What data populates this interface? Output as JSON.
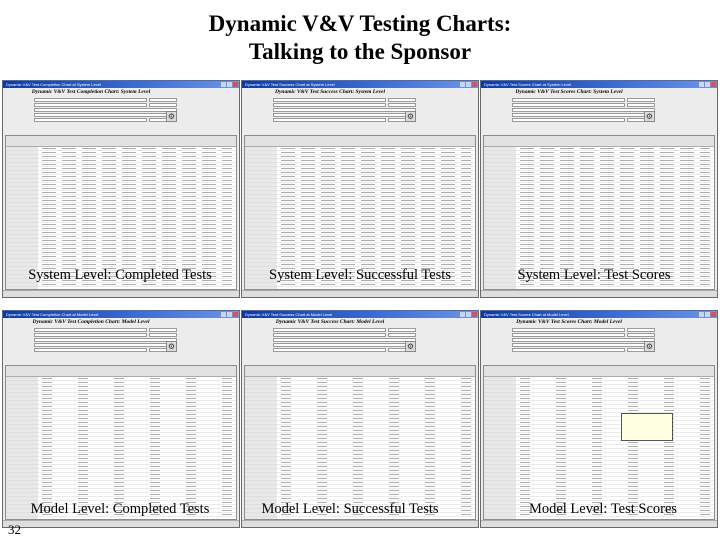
{
  "slide": {
    "title_line1": "Dynamic V&V Testing Charts:",
    "title_line2": "Talking to the Sponsor",
    "page_number": "32"
  },
  "window_controls": {
    "icons": [
      "minimize-icon",
      "maximize-icon",
      "close-icon"
    ]
  },
  "gear_icon": {
    "glyph": "⚙"
  },
  "screenshots": [
    {
      "caption": "System Level: Completed Tests",
      "chart_heading": "Dynamic V&V Test Completion Chart: System Level",
      "window_title": "Dynamic V&V Test Completion Chart at System Level"
    },
    {
      "caption": "System Level: Successful Tests",
      "chart_heading": "Dynamic V&V Test Success Chart: System Level",
      "window_title": "Dynamic V&V Test Success Chart at System Level"
    },
    {
      "caption": "System Level: Test Scores",
      "chart_heading": "Dynamic V&V Test Scores Chart: System Level",
      "window_title": "Dynamic V&V Test Scores Chart at System Level"
    },
    {
      "caption": "Model Level: Completed Tests",
      "chart_heading": "Dynamic V&V Test Completion Chart: Model Level",
      "window_title": "Dynamic V&V Test Completion Chart at Model Level"
    },
    {
      "caption": "Model Level: Successful Tests",
      "chart_heading": "Dynamic V&V Test Success Chart: Model Level",
      "window_title": "Dynamic V&V Test Success Chart at Model Level"
    },
    {
      "caption": "Model Level: Test Scores",
      "chart_heading": "Dynamic V&V Test Scores Chart: Model Level",
      "window_title": "Dynamic V&V Test Scores Chart at Model Level"
    }
  ]
}
